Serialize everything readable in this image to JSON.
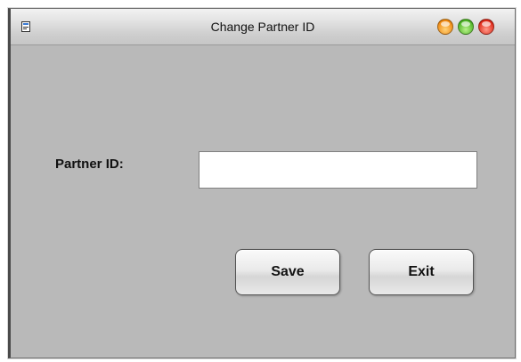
{
  "window": {
    "title": "Change Partner ID"
  },
  "form": {
    "partner_id_label": "Partner ID:",
    "partner_id_value": "",
    "partner_id_placeholder": ""
  },
  "buttons": {
    "save_label": "Save",
    "exit_label": "Exit"
  },
  "icons": {
    "app": "app-icon",
    "minimize": "minimize-icon",
    "maximize": "maximize-icon",
    "close": "close-icon"
  },
  "colors": {
    "window_background": "#b9b9b9",
    "minimize": "#f08a12",
    "maximize": "#4fb526",
    "close": "#e02a1a"
  }
}
